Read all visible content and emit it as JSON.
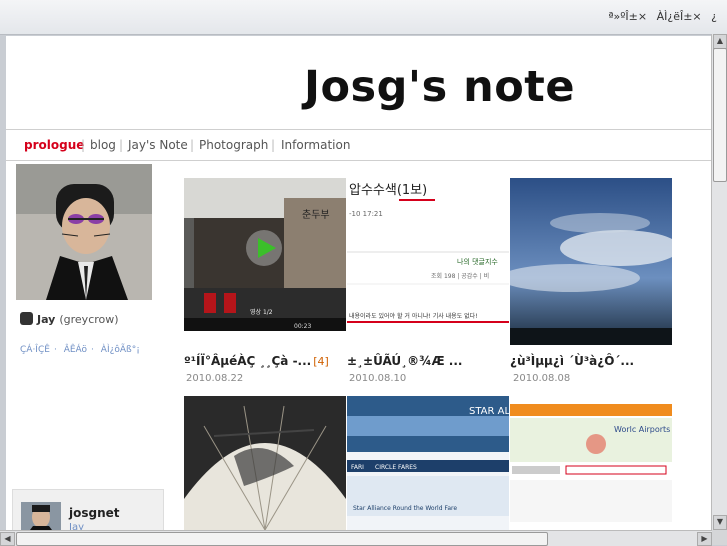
{
  "browser": {
    "top_links": [
      "ª»ºÎ±×",
      "ÀÌ¿ëÎ±×",
      "¿"
    ]
  },
  "blog": {
    "title": "Josg's note",
    "nav": [
      {
        "label": "prologue",
        "active": true
      },
      {
        "label": "blog",
        "active": false
      },
      {
        "label": "Jay's Note",
        "active": false
      },
      {
        "label": "Photograph",
        "active": false
      },
      {
        "label": "Information",
        "active": false
      }
    ]
  },
  "profile": {
    "name": "Jay",
    "handle": "(greycrow)",
    "menu": [
      "ÇÁ·ÎÇÊ",
      "ÂÊÁö",
      "ÀÌ¿ôÃß°¡"
    ],
    "mini_name": "josgnet",
    "mini_sub": "Jay"
  },
  "posts": [
    {
      "caption": "º¹ÍÏ°ÂµéÀÇ ¸¸Çà -...",
      "count": "[4]",
      "date": "2010.08.22",
      "thumb_text": "춘두부"
    },
    {
      "caption": "±¸±ÛÃÚ¸®¾Æ ...",
      "count": "",
      "date": "2010.08.10",
      "thumb_text": "압수수색(1보)"
    },
    {
      "caption": "¿ù³Ìµµ¿ì ´Ù³à¿Ô´...",
      "count": "",
      "date": "2010.08.08",
      "thumb_text": ""
    },
    {
      "caption": "",
      "count": "",
      "date": "",
      "thumb_text": ""
    },
    {
      "caption": "",
      "count": "",
      "date": "",
      "thumb_text": "Star Alliance Round the World Fare"
    },
    {
      "caption": "",
      "count": "",
      "date": "",
      "thumb_text": "Worlc Airports"
    }
  ],
  "post_extra": {
    "time": "-10 17:21",
    "line1": "나의 댓글지수",
    "line2": "조회 198 | 공감수 | 비",
    "line3": "내용이라도 있어야 할 거 아니냐! 기사 내용도 없다!",
    "circle_fares": "CIRCLE FARES",
    "fari": "FARI",
    "star_alliance": "STAR AL",
    "video_time": "00:23",
    "video_label": "영상 1/2"
  },
  "colors": {
    "nav_active": "#d5001b",
    "menu_link": "#6f8fc4",
    "count": "#d06000"
  }
}
